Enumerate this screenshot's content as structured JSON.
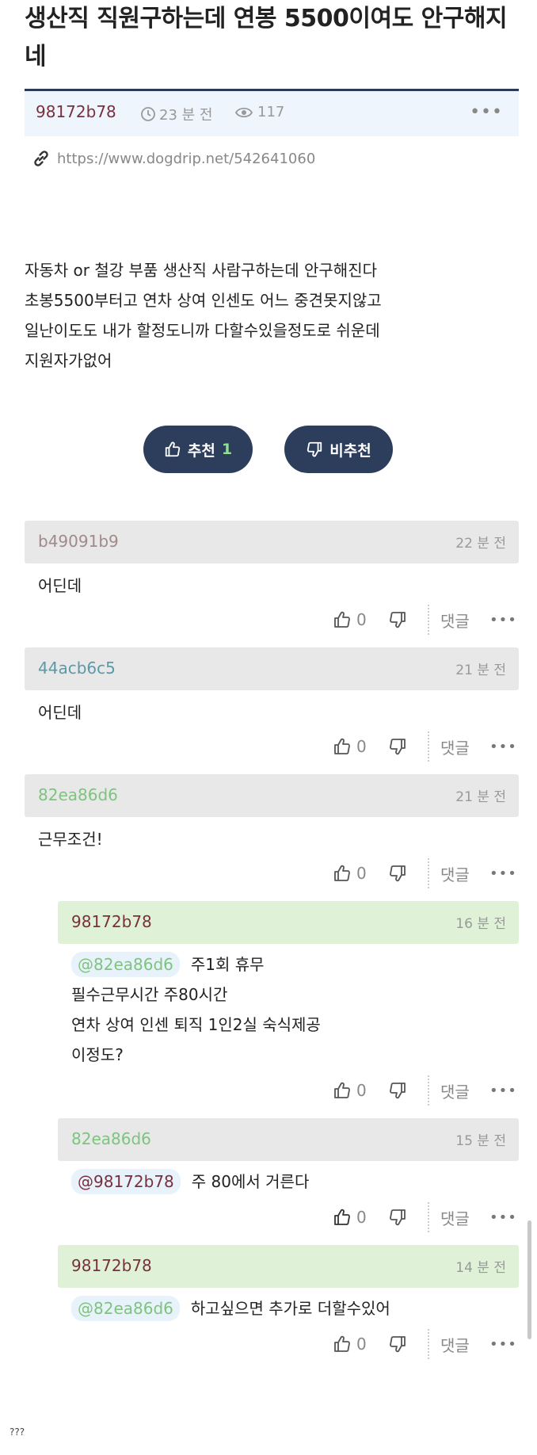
{
  "post": {
    "title": "생산직 직원구하는데 연봉 5500이여도 안구해지네",
    "author": "98172b78",
    "time": "23 분 전",
    "views": "117",
    "more": "•••",
    "url": "https://www.dogdrip.net/542641060",
    "body_lines": [
      "자동차 or 철강 부품 생산직 사람구하는데 안구해진다",
      "초봉5500부터고 연차 상여 인센도 어느 중견못지않고",
      "일난이도도 내가 할정도니까 다할수있을정도로 쉬운데",
      "지원자가없어"
    ],
    "upvote_label": "추천",
    "upvote_count": "1",
    "downvote_label": "비추천"
  },
  "comments": [
    {
      "author": "b49091b9",
      "author_color": "#a08a8a",
      "time": "22 분 전",
      "lines": [
        "어딘데"
      ],
      "likes": "0",
      "reply": "댓글",
      "more": "•••"
    },
    {
      "author": "44acb6c5",
      "author_color": "#5a9aa8",
      "time": "21 분 전",
      "lines": [
        "어딘데"
      ],
      "likes": "0",
      "reply": "댓글",
      "more": "•••"
    },
    {
      "author": "82ea86d6",
      "author_color": "#7dc47d",
      "time": "21 분 전",
      "lines": [
        "근무조건!"
      ],
      "likes": "0",
      "reply": "댓글",
      "more": "•••"
    },
    {
      "author": "98172b78",
      "author_color": "#7a2f3c",
      "time": "16 분 전",
      "mention": "@82ea86d6",
      "mention_color": "#7dc47d",
      "lines": [
        "주1회 휴무",
        "필수근무시간 주80시간",
        "연차 상여 인센 퇴직 1인2실 숙식제공",
        "이정도?"
      ],
      "likes": "0",
      "reply": "댓글",
      "more": "•••"
    },
    {
      "author": "82ea86d6",
      "author_color": "#7dc47d",
      "time": "15 분 전",
      "mention": "@98172b78",
      "mention_color": "#7a2f3c",
      "lines": [
        "주 80에서 거른다"
      ],
      "likes": "0",
      "reply": "댓글",
      "more": "•••"
    },
    {
      "author": "98172b78",
      "author_color": "#7a2f3c",
      "time": "14 분 전",
      "mention": "@82ea86d6",
      "mention_color": "#7dc47d",
      "lines": [
        "하고싶으면 추가로 더할수있어"
      ],
      "likes": "0",
      "reply": "댓글",
      "more": "•••"
    }
  ],
  "footer": "???"
}
